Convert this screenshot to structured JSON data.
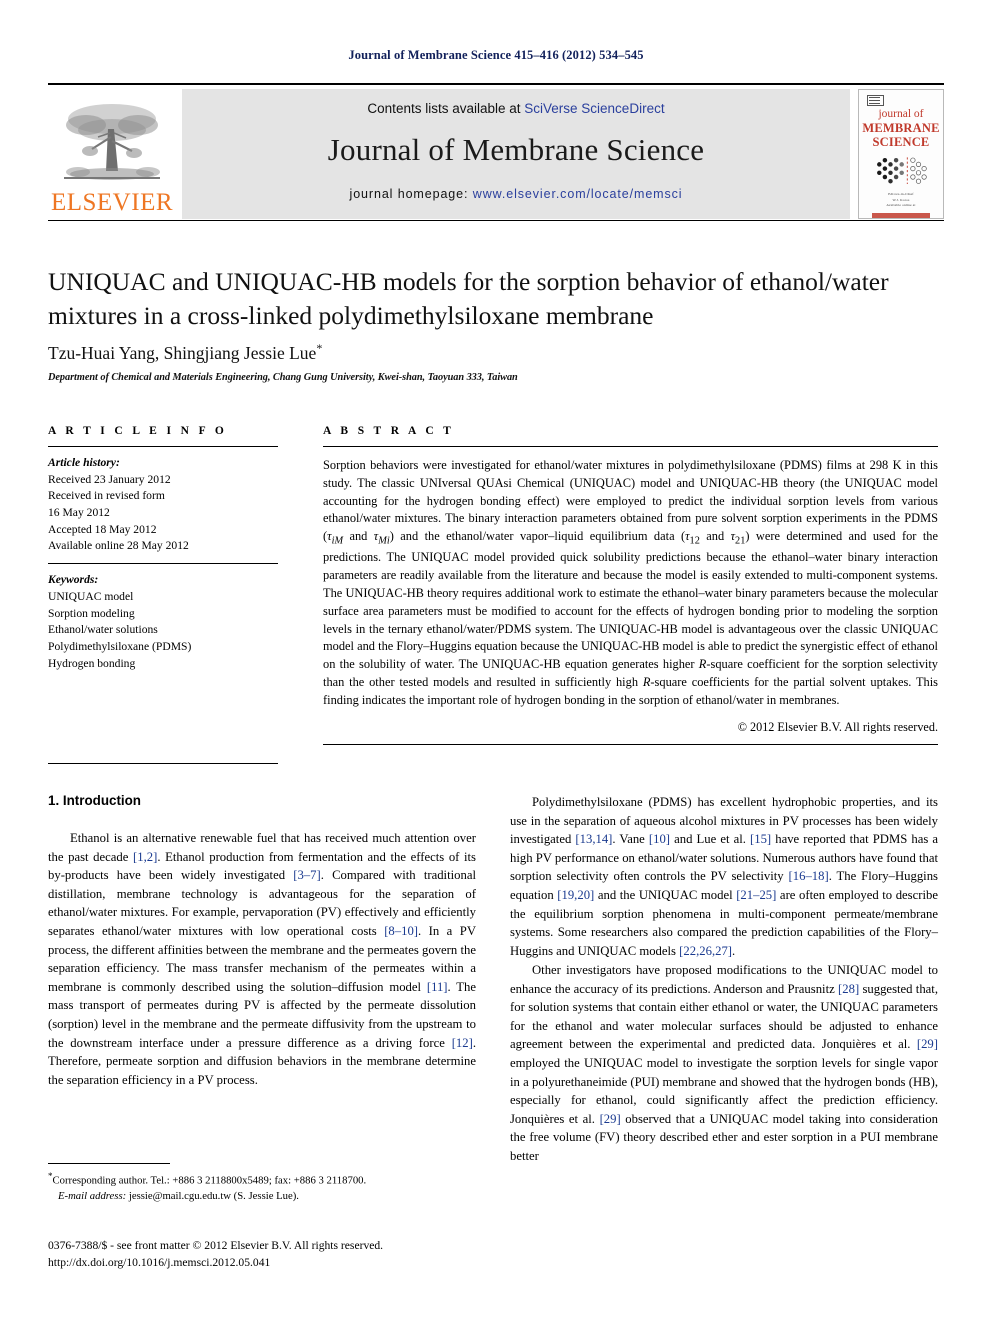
{
  "running_head": "Journal of Membrane Science 415–416 (2012) 534–545",
  "masthead": {
    "publisher_wordmark": "ELSEVIER",
    "contents_prefix": "Contents lists available at ",
    "contents_link": "SciVerse ScienceDirect",
    "journal_name": "Journal of Membrane Science",
    "homepage_prefix": "journal homepage: ",
    "homepage_link": "www.elsevier.com/locate/memsci",
    "cover": {
      "line1": "journal of",
      "line2": "MEMBRANE",
      "line3": "SCIENCE",
      "foot1": "Editors-in-Chief",
      "foot2": "W.J. Koros",
      "foot3": "Available online at",
      "foot4": "SciVerse ScienceDirect"
    }
  },
  "article": {
    "title": "UNIQUAC and UNIQUAC-HB models for the sorption behavior of ethanol/water mixtures in a cross-linked polydimethylsiloxane membrane",
    "authors": "Tzu-Huai Yang, Shingjiang Jessie Lue",
    "author_marker": "*",
    "affiliation": "Department of Chemical and Materials Engineering, Chang Gung University, Kwei-shan, Taoyuan 333, Taiwan"
  },
  "article_info": {
    "heading": "A R T I C L E   I N F O",
    "history_label": "Article history:",
    "history": [
      "Received 23 January 2012",
      "Received in revised form",
      "16 May 2012",
      "Accepted 18 May 2012",
      "Available online 28 May 2012"
    ],
    "keywords_label": "Keywords:",
    "keywords": [
      "UNIQUAC model",
      "Sorption modeling",
      "Ethanol/water solutions",
      "Polydimethylsiloxane (PDMS)",
      "Hydrogen bonding"
    ]
  },
  "abstract": {
    "heading": "A B S T R A C T",
    "text": "Sorption behaviors were investigated for ethanol/water mixtures in polydimethylsiloxane (PDMS) films at 298 K in this study. The classic UNIversal QUAsi Chemical (UNIQUAC) model and UNIQUAC-HB theory (the UNIQUAC model accounting for the hydrogen bonding effect) were employed to predict the individual sorption levels from various ethanol/water mixtures. The binary interaction parameters obtained from pure solvent sorption experiments in the PDMS (τiM and τMi) and the ethanol/water vapor–liquid equilibrium data (τ12 and τ21) were determined and used for the predictions. The UNIQUAC model provided quick solubility predictions because the ethanol–water binary interaction parameters are readily available from the literature and because the model is easily extended to multi-component systems. The UNIQUAC-HB theory requires additional work to estimate the ethanol–water binary parameters because the molecular surface area parameters must be modified to account for the effects of hydrogen bonding prior to modeling the sorption levels in the ternary ethanol/water/PDMS system. The UNIQUAC-HB model is advantageous over the classic UNIQUAC model and the Flory–Huggins equation because the UNIQUAC-HB model is able to predict the synergistic effect of ethanol on the solubility of water. The UNIQUAC-HB equation generates higher R-square coefficient for the sorption selectivity than the other tested models and resulted in sufficiently high R-square coefficients for the partial solvent uptakes. This finding indicates the important role of hydrogen bonding in the sorption of ethanol/water in membranes.",
    "copyright": "© 2012 Elsevier B.V. All rights reserved."
  },
  "body": {
    "section_heading": "1.  Introduction",
    "left_paragraphs": [
      "Ethanol is an alternative renewable fuel that has received much attention over the past decade [1,2]. Ethanol production from fermentation and the effects of its by-products have been widely investigated [3–7]. Compared with traditional distillation, membrane technology is advantageous for the separation of ethanol/water mixtures. For example, pervaporation (PV) effectively and efficiently separates ethanol/water mixtures with low operational costs [8–10]. In a PV process, the different affinities between the membrane and the permeates govern the separation efficiency. The mass transfer mechanism of the permeates within a membrane is commonly described using the solution–diffusion model [11]. The mass transport of permeates during PV is affected by the permeate dissolution (sorption) level in the membrane and the permeate diffusivity from the upstream to the downstream interface under a pressure difference as a driving force [12]. Therefore, permeate sorption and diffusion behaviors in the membrane determine the separation efficiency in a PV process."
    ],
    "right_paragraphs": [
      "Polydimethylsiloxane (PDMS) has excellent hydrophobic properties, and its use in the separation of aqueous alcohol mixtures in PV processes has been widely investigated [13,14]. Vane [10] and Lue et al. [15] have reported that PDMS has a high PV performance on ethanol/water solutions. Numerous authors have found that sorption selectivity often controls the PV selectivity [16–18]. The Flory–Huggins equation [19,20] and the UNIQUAC model [21–25] are often employed to describe the equilibrium sorption phenomena in multi-component permeate/membrane systems. Some researchers also compared the prediction capabilities of the Flory–Huggins and UNIQUAC models [22,26,27].",
      "Other investigators have proposed modifications to the UNIQUAC model to enhance the accuracy of its predictions. Anderson and Prausnitz [28] suggested that, for solution systems that contain either ethanol or water, the UNIQUAC parameters for the ethanol and water molecular surfaces should be adjusted to enhance agreement between the experimental and predicted data. Jonquières et al. [29] employed the UNIQUAC model to investigate the sorption levels for single vapor in a polyurethaneimide (PUI) membrane and showed that the hydrogen bonds (HB), especially for ethanol, could significantly affect the prediction efficiency. Jonquières et al. [29] observed that a UNIQUAC model taking into consideration the free volume (FV) theory described ether and ester sorption in a PUI membrane better"
    ]
  },
  "footnote": {
    "marker": "*",
    "corresponding": "Corresponding author. Tel.: +886 3 2118800x5489; fax: +886 3 2118700.",
    "email_label": "E-mail address:",
    "email": "jessie@mail.cgu.edu.tw (S. Jessie Lue)."
  },
  "imprint": {
    "line1": "0376-7388/$ - see front matter © 2012 Elsevier B.V. All rights reserved.",
    "line2": "http://dx.doi.org/10.1016/j.memsci.2012.05.041"
  },
  "colors": {
    "running_head": "#12215b",
    "link": "#2a3f9d",
    "reference": "#1a3a8f",
    "elsevier_orange": "#ee7623",
    "cover_red": "#c0392b",
    "banner_gray": "#e4e4e4"
  }
}
